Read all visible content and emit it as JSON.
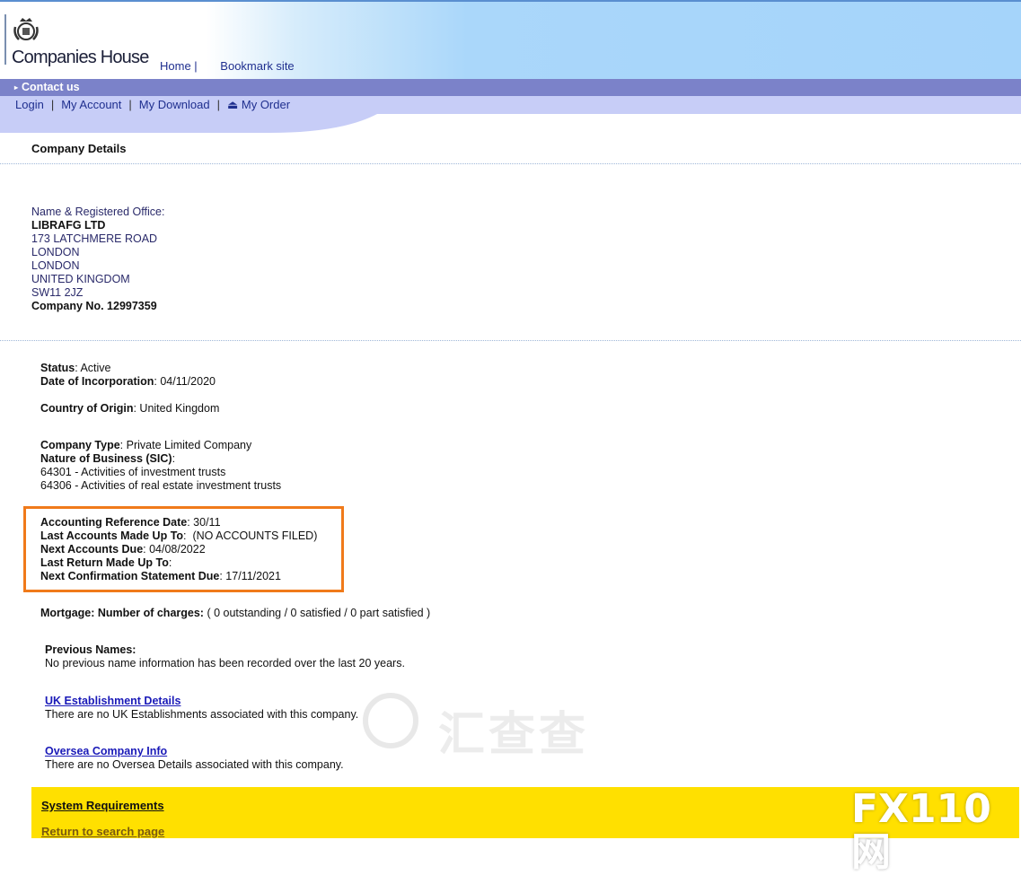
{
  "header": {
    "logo_text": "Companies House",
    "nav": [
      "Home |",
      "Bookmark site"
    ]
  },
  "contact_bar": {
    "label": "Contact us"
  },
  "account_nav": {
    "login": "Login",
    "my_account": "My Account",
    "my_download": "My Download",
    "my_order": "My Order"
  },
  "page_title": "Company Details",
  "company": {
    "name_label": "Name & Registered Office:",
    "name": "LIBRAFG LTD",
    "address": [
      "173 LATCHMERE ROAD",
      "LONDON",
      "LONDON",
      "UNITED KINGDOM",
      "SW11 2JZ"
    ],
    "number_label": "Company No.",
    "number": "12997359"
  },
  "status": {
    "label": "Status",
    "value": ": Active"
  },
  "incorporation": {
    "label": "Date of Incorporation",
    "value": ": 04/11/2020"
  },
  "origin": {
    "label": "Country of Origin",
    "value": ": United Kingdom"
  },
  "company_type": {
    "label": "Company Type",
    "value": ": Private Limited Company"
  },
  "nature": {
    "label": "Nature of Business (SIC)",
    "suffix": ":",
    "items": [
      "64301 - Activities of investment trusts",
      "64306 - Activities of real estate investment trusts"
    ]
  },
  "accounts": {
    "ref_date_label": "Accounting Reference Date",
    "ref_date": ": 30/11",
    "last_accounts_label": "Last Accounts Made Up To",
    "last_accounts": ":  (NO ACCOUNTS FILED)",
    "next_accounts_label": "Next Accounts Due",
    "next_accounts": ": 04/08/2022",
    "last_return_label": "Last Return Made Up To",
    "last_return": ":",
    "next_conf_label": "Next Confirmation Statement Due",
    "next_conf": ": 17/11/2021"
  },
  "mortgage": {
    "label": "Mortgage: Number of charges:",
    "value": " ( 0 outstanding / 0 satisfied / 0 part satisfied )"
  },
  "previous_names": {
    "label": "Previous Names:",
    "text": "No previous name information has been recorded over the last 20 years."
  },
  "uk_establishment": {
    "link": "UK Establishment Details",
    "text": "There are no UK Establishments associated with this company."
  },
  "oversea": {
    "link": "Oversea Company Info",
    "text": "There are no Oversea Details associated with this company."
  },
  "footer": {
    "system_requirements": "System Requirements",
    "return_link": "Return to search page"
  },
  "watermarks": {
    "center": "汇查查",
    "brand": "FX110网"
  },
  "colors": {
    "highlight_box": "#f07a1a",
    "footer_bg": "#ffe000",
    "contact_bar": "#7b82c9",
    "account_bar": "#c7cdf7"
  }
}
